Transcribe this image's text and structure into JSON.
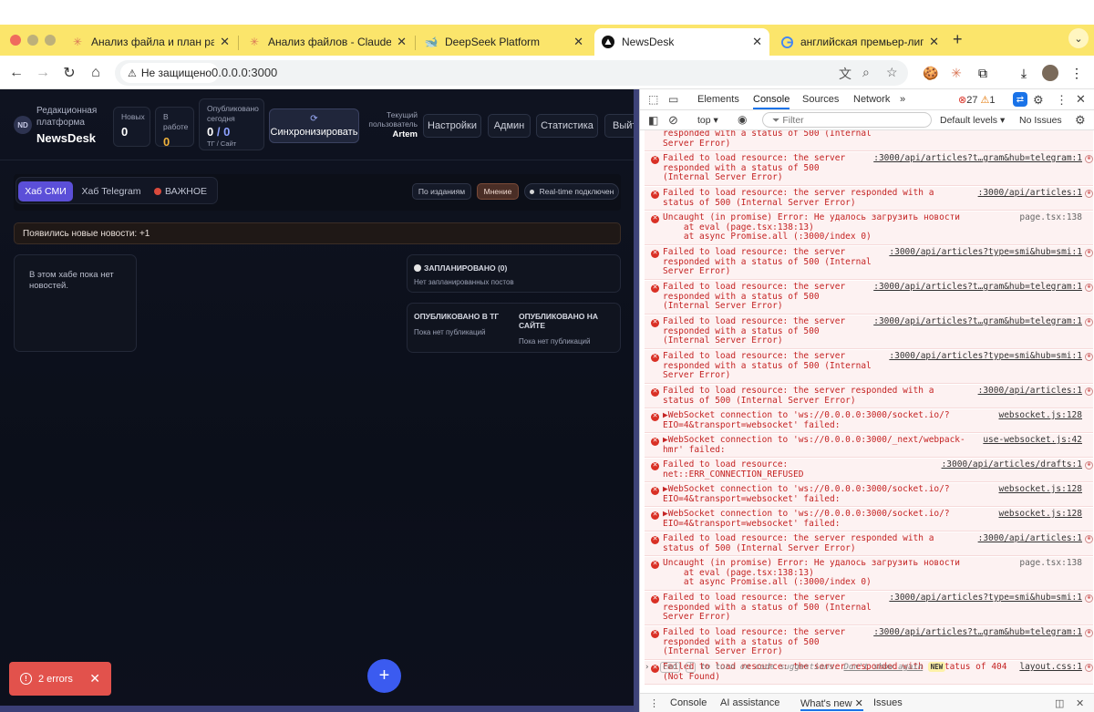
{
  "browser": {
    "tabs": [
      {
        "title": "Анализ файла и план работы",
        "favicon": "claude-asterisk-icon"
      },
      {
        "title": "Анализ файлов - Claude",
        "favicon": "claude-asterisk-icon"
      },
      {
        "title": "DeepSeek Platform",
        "favicon": "deepseek-whale-icon"
      },
      {
        "title": "NewsDesk",
        "favicon": "triangle-logo-icon",
        "active": true
      },
      {
        "title": "английская премьер-лига -",
        "favicon": "google-g-icon"
      }
    ],
    "security_label": "Не защищено",
    "url": "0.0.0.0:3000"
  },
  "app": {
    "logo": "ND",
    "brand_sub": "Редакционная платформа",
    "brand_name": "NewsDesk",
    "stats": [
      {
        "label": "Новых",
        "value": "0"
      },
      {
        "label": "В работе",
        "value": "0"
      },
      {
        "label": "Опубликовано сегодня",
        "value_a": "0",
        "sep": "/",
        "value_b": "0",
        "sub": "ТГ / Сайт"
      }
    ],
    "sync_label": "Синхронизировать",
    "user_label": "Текущий пользователь",
    "user_name": "Artem",
    "nav": [
      "Настройки",
      "Админ",
      "Статистика",
      "Выйти"
    ],
    "hub_tabs": [
      "Хаб СМИ",
      "Хаб Telegram",
      "ВАЖНОЕ"
    ],
    "filters": [
      "По изданиям",
      "Мнение"
    ],
    "realtime": "Real-time подключен",
    "notice": "Появились новые новости: +1",
    "empty_hub": "В этом хабе пока нет новостей.",
    "scheduled_title": "ЗАПЛАНИРОВАНО (0)",
    "scheduled_empty": "Нет запланированных постов",
    "pub_tg_title": "ОПУБЛИКОВАНО В ТГ",
    "pub_tg_empty": "Пока нет публикаций",
    "pub_site_title": "ОПУБЛИКОВАНО НА САЙТЕ",
    "pub_site_empty": "Пока нет публикаций",
    "errors_toast": "2 errors",
    "fab": "+"
  },
  "devtools": {
    "tabs": [
      "Elements",
      "Console",
      "Sources",
      "Network"
    ],
    "error_count": "27",
    "warn_count": "1",
    "context": "top",
    "filter_placeholder": "Filter",
    "levels": "Default levels",
    "issues": "No Issues",
    "messages": [
      {
        "text": "responded with a status of 500 (Internal\nServer Error)",
        "src": ""
      },
      {
        "text": "Failed to load resource: the server\nresponded with a status of 500\n(Internal Server Error)",
        "src": ":3000/api/articles?t…gram&hub=telegram:1"
      },
      {
        "text": "Failed to load resource: the server responded with a\nstatus of 500 (Internal Server Error)",
        "src": ":3000/api/articles:1"
      },
      {
        "text": "Uncaught (in promise) Error: Не удалось загрузить новости\n    at eval (page.tsx:138:13)\n    at async Promise.all (:3000/index 0)",
        "src": "page.tsx:138"
      },
      {
        "text": "Failed to load resource: the server\nresponded with a status of 500 (Internal\nServer Error)",
        "src": ":3000/api/articles?type=smi&hub=smi:1"
      },
      {
        "text": "Failed to load resource: the server\nresponded with a status of 500\n(Internal Server Error)",
        "src": ":3000/api/articles?t…gram&hub=telegram:1"
      },
      {
        "text": "Failed to load resource: the server\nresponded with a status of 500\n(Internal Server Error)",
        "src": ":3000/api/articles?t…gram&hub=telegram:1"
      },
      {
        "text": "Failed to load resource: the server\nresponded with a status of 500 (Internal\nServer Error)",
        "src": ":3000/api/articles?type=smi&hub=smi:1"
      },
      {
        "text": "Failed to load resource: the server responded with a\nstatus of 500 (Internal Server Error)",
        "src": ":3000/api/articles:1"
      },
      {
        "text": "▶WebSocket connection to 'ws://0.0.0.0:3000/socket.io/?\nEIO=4&transport=websocket' failed:",
        "src": "websocket.js:128"
      },
      {
        "text": "▶WebSocket connection to 'ws://0.0.0.0:3000/_next/webpack-\nhmr' failed:",
        "src": "use-websocket.js:42"
      },
      {
        "text": "Failed to load resource:\nnet::ERR_CONNECTION_REFUSED",
        "src": ":3000/api/articles/drafts:1"
      },
      {
        "text": "▶WebSocket connection to 'ws://0.0.0.0:3000/socket.io/?\nEIO=4&transport=websocket' failed:",
        "src": "websocket.js:128"
      },
      {
        "text": "▶WebSocket connection to 'ws://0.0.0.0:3000/socket.io/?\nEIO=4&transport=websocket' failed:",
        "src": "websocket.js:128"
      },
      {
        "text": "Failed to load resource: the server responded with a\nstatus of 500 (Internal Server Error)",
        "src": ":3000/api/articles:1"
      },
      {
        "text": "Uncaught (in promise) Error: Не удалось загрузить новости\n    at eval (page.tsx:138:13)\n    at async Promise.all (:3000/index 0)",
        "src": "page.tsx:138"
      },
      {
        "text": "Failed to load resource: the server\nresponded with a status of 500 (Internal\nServer Error)",
        "src": ":3000/api/articles?type=smi&hub=smi:1"
      },
      {
        "text": "Failed to load resource: the server\nresponded with a status of 500\n(Internal Server Error)",
        "src": ":3000/api/articles?t…gram&hub=telegram:1"
      },
      {
        "text": "Failed to load resource: the server responded with a status of 404\n(Not Found)",
        "src": "layout.css:1"
      }
    ],
    "prompt_hint": "to turn on code suggestions.",
    "prompt_cmd": "cmd",
    "prompt_key": "i",
    "dont_show": "Don't show again",
    "new_badge": "NEW",
    "bottom_tabs": [
      "Console",
      "AI assistance",
      "What's new",
      "Issues"
    ]
  }
}
